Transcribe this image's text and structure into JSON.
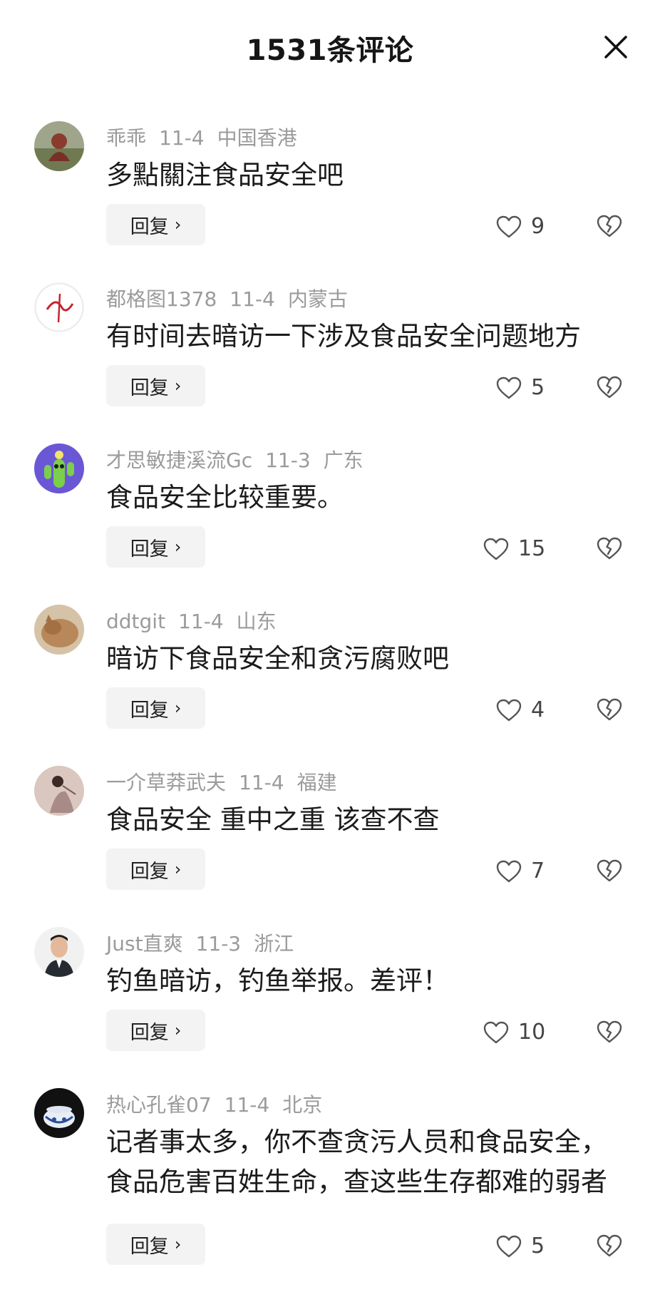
{
  "header": {
    "title": "1531条评论"
  },
  "comments": [
    {
      "user": "乖乖",
      "date": "11-4",
      "location": "中国香港",
      "text": "多點關注食品安全吧",
      "reply": "回复",
      "likes": "9"
    },
    {
      "user": "都格图1378",
      "date": "11-4",
      "location": "内蒙古",
      "text": "有时间去暗访一下涉及食品安全问题地方",
      "reply": "回复",
      "likes": "5"
    },
    {
      "user": "才思敏捷溪流Gc",
      "date": "11-3",
      "location": "广东",
      "text": "食品安全比较重要。",
      "reply": "回复",
      "likes": "15"
    },
    {
      "user": "ddtgit",
      "date": "11-4",
      "location": "山东",
      "text": "暗访下食品安全和贪污腐败吧",
      "reply": "回复",
      "likes": "4"
    },
    {
      "user": "一介草莽武夫",
      "date": "11-4",
      "location": "福建",
      "text": "食品安全 重中之重 该查不查",
      "reply": "回复",
      "likes": "7"
    },
    {
      "user": "Just直爽",
      "date": "11-3",
      "location": "浙江",
      "text": "钓鱼暗访，钓鱼举报。差评！",
      "reply": "回复",
      "likes": "10"
    },
    {
      "user": "热心孔雀07",
      "date": "11-4",
      "location": "北京",
      "text": "记者事太多，你不查贪污人员和食品安全，食品危害百姓生命，查这些生存都难的弱者",
      "reply": "回复",
      "likes": "5"
    }
  ],
  "icons": {
    "close": "close-icon",
    "like": "heart-outline-icon",
    "dislike": "broken-heart-icon",
    "reply_chevron": "chevron-right-icon"
  }
}
